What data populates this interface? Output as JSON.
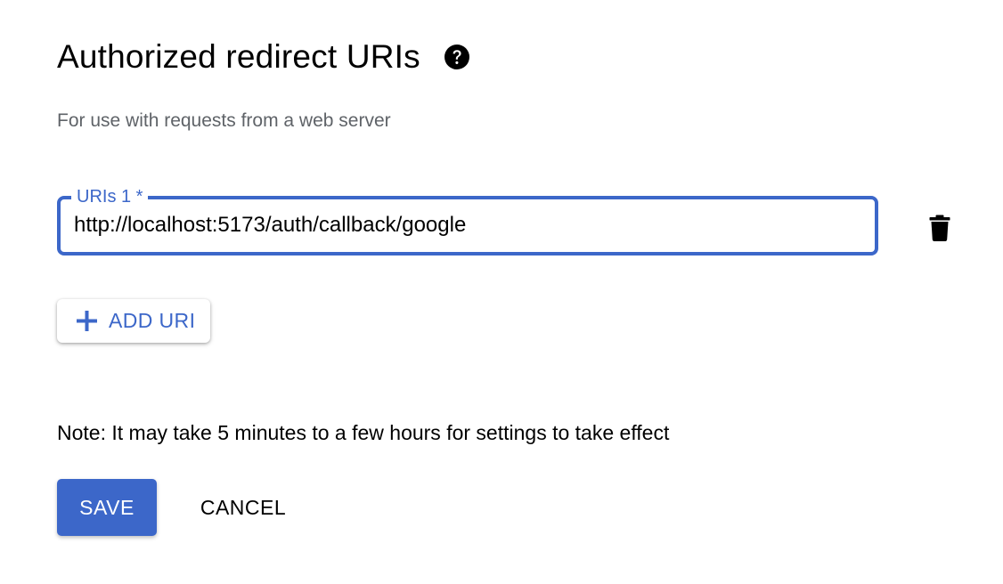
{
  "section": {
    "title": "Authorized redirect URIs",
    "help_icon": "help-circle-icon",
    "subtitle": "For use with requests from a web server"
  },
  "uri_field": {
    "label": "URIs 1 *",
    "value": "http://localhost:5173/auth/callback/google",
    "delete_icon": "trash-icon"
  },
  "add_uri_button": {
    "icon": "plus-icon",
    "label": "ADD URI"
  },
  "note": "Note: It may take 5 minutes to a few hours for settings to take effect",
  "actions": {
    "save_label": "SAVE",
    "cancel_label": "CANCEL"
  },
  "colors": {
    "accent": "#3c67c9",
    "subtitle_text": "#5f6368",
    "text": "#000000"
  }
}
